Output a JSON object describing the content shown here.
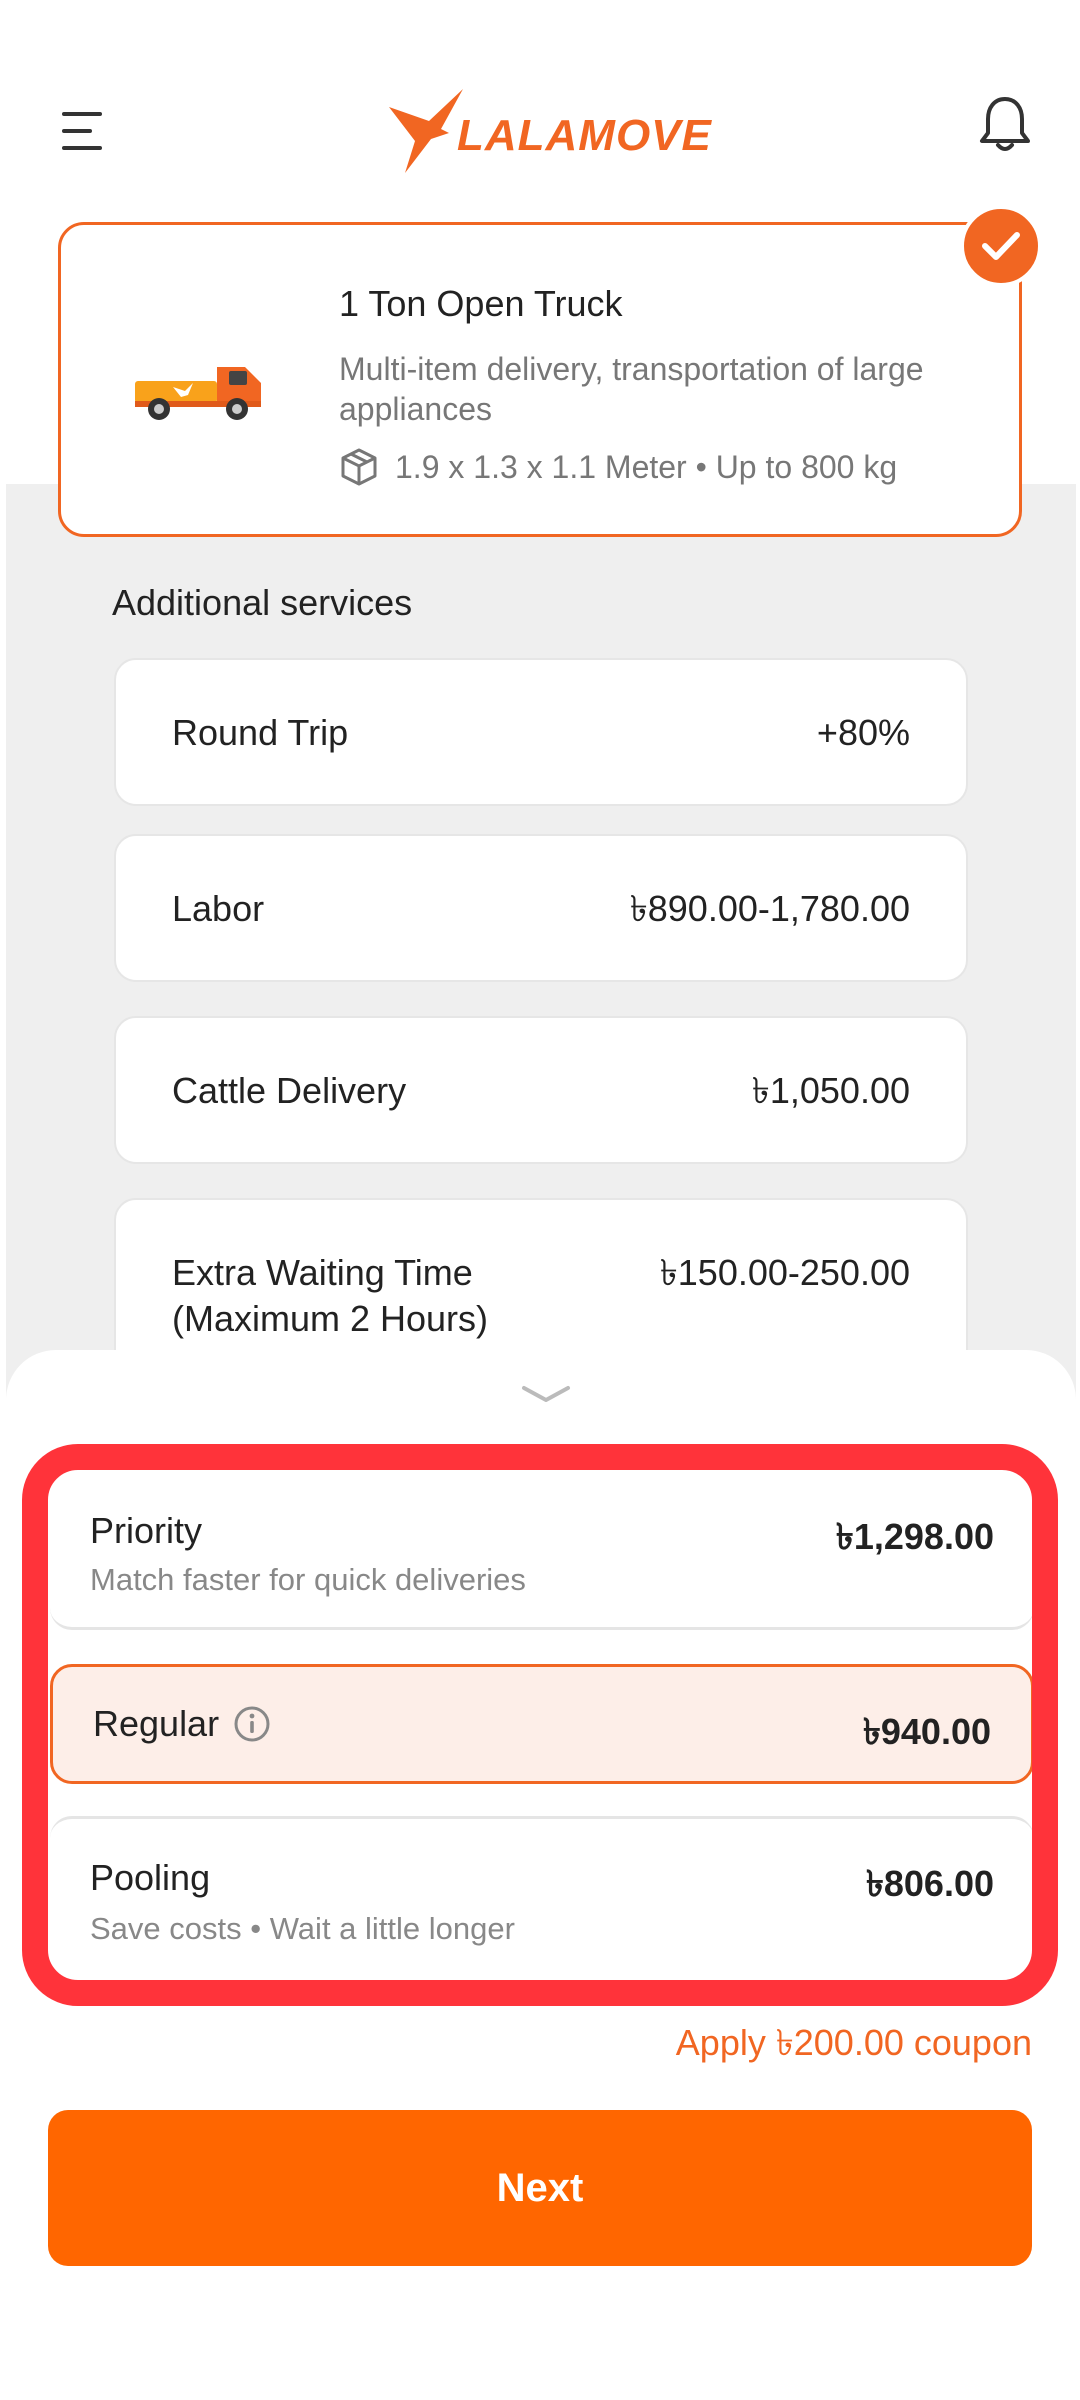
{
  "header": {
    "brand": "LALAMOVE",
    "icons": {
      "menu": "hamburger-menu-icon",
      "notifications": "bell-icon"
    }
  },
  "vehicle": {
    "title": "1 Ton Open Truck",
    "description": "Multi-item delivery, transportation of large appliances",
    "spec": "1.9 x 1.3 x 1.1 Meter • Up to 800 kg",
    "selected": true,
    "accent_color": "#f16622"
  },
  "additional_services": {
    "title": "Additional services",
    "items": [
      {
        "name": "Round Trip",
        "price": "+80%"
      },
      {
        "name": "Labor",
        "price": "৳890.00-1,780.00"
      },
      {
        "name": "Cattle Delivery",
        "price": "৳1,050.00"
      },
      {
        "name": "Extra Waiting Time (Maximum 2 Hours)",
        "price": "৳150.00-250.00"
      }
    ]
  },
  "delivery_options": [
    {
      "name": "Priority",
      "subtitle": "Match faster for quick deliveries",
      "price": "৳1,298.00",
      "selected": false
    },
    {
      "name": "Regular",
      "subtitle": "",
      "price": "৳940.00",
      "selected": true
    },
    {
      "name": "Pooling",
      "subtitle": "Save costs • Wait a little longer",
      "price": "৳806.00",
      "selected": false
    }
  ],
  "coupon": {
    "label": "Apply ৳200.00 coupon"
  },
  "next_button": {
    "label": "Next",
    "color": "#ff6600"
  },
  "highlight_color": "#ff333a"
}
